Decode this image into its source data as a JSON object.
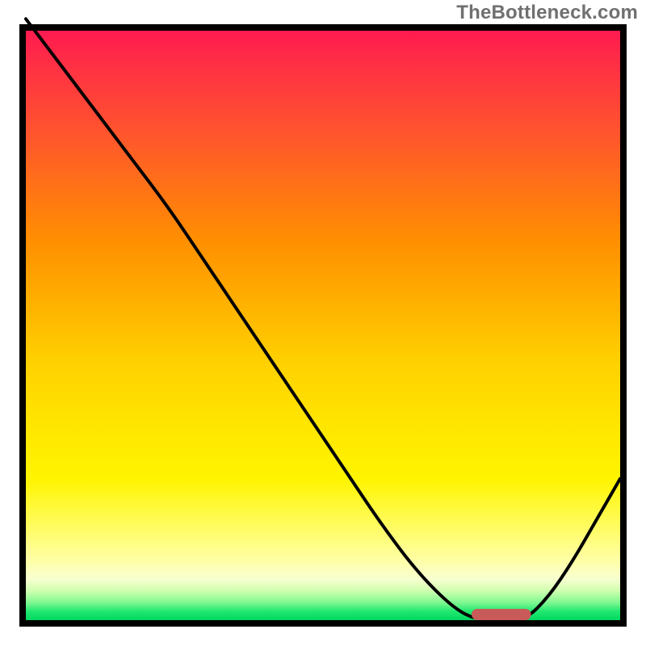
{
  "watermark": "TheBottleneck.com",
  "colors": {
    "curve": "#000000",
    "marker": "#c95a5a",
    "border": "#000000"
  },
  "chart_data": {
    "type": "line",
    "title": "",
    "xlabel": "",
    "ylabel": "",
    "xlim": [
      0,
      100
    ],
    "ylim": [
      0,
      100
    ],
    "grid": false,
    "series": [
      {
        "name": "bottleneck-curve",
        "x": [
          0,
          6,
          12,
          18,
          24,
          30,
          36,
          42,
          48,
          54,
          60,
          66,
          72,
          76,
          80,
          84,
          88,
          92,
          96,
          100
        ],
        "y": [
          102,
          94,
          86,
          78,
          70,
          61,
          52,
          43,
          34,
          25,
          16,
          8,
          2,
          0,
          0,
          0,
          4,
          10,
          17,
          24
        ]
      }
    ],
    "marker": {
      "x_start": 75,
      "x_end": 85,
      "y": 0
    },
    "gradient_colors_top_to_bottom": [
      "#ff1a50",
      "#ff5030",
      "#ff9000",
      "#ffd000",
      "#fff400",
      "#ffffa8",
      "#80f890",
      "#00d860"
    ]
  }
}
